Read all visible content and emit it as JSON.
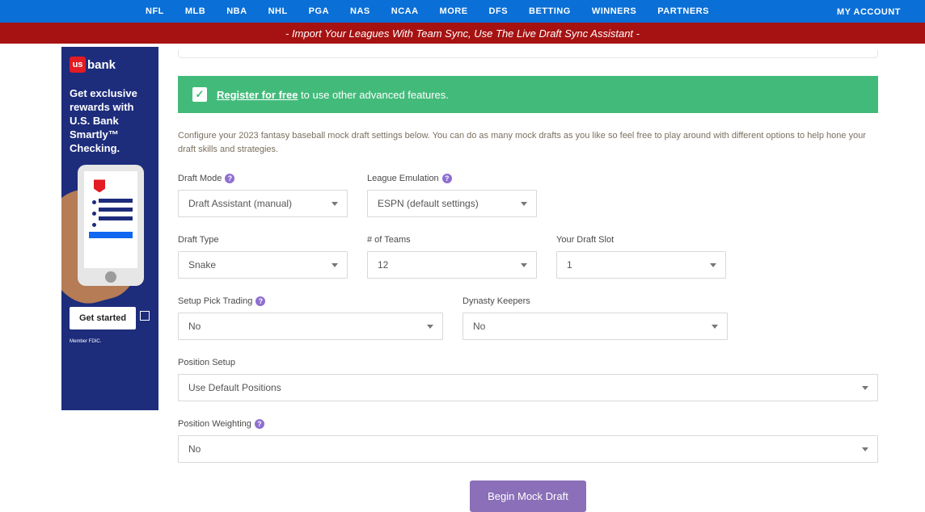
{
  "topnav": {
    "items": [
      "NFL",
      "MLB",
      "NBA",
      "NHL",
      "PGA",
      "NAS",
      "NCAA",
      "MORE",
      "DFS",
      "BETTING",
      "WINNERS",
      "PARTNERS"
    ],
    "account": "MY ACCOUNT"
  },
  "import_bar": "- Import Your Leagues With Team Sync, Use The Live Draft Sync Assistant -",
  "ad": {
    "logo_text": "bank",
    "logo_us": "us",
    "copy": "Get exclusive rewards with U.S. Bank Smartly™ Checking.",
    "cta": "Get started",
    "disclaim": "Member FDIC."
  },
  "banner": {
    "link": "Register for free",
    "rest": " to use other advanced features."
  },
  "intro": "Configure your 2023 fantasy baseball mock draft settings below. You can do as many mock drafts as you like so feel free to play around with different options to help hone your draft skills and strategies.",
  "form": {
    "draft_mode": {
      "label": "Draft Mode",
      "value": "Draft Assistant (manual)"
    },
    "league_emulation": {
      "label": "League Emulation",
      "value": "ESPN (default settings)"
    },
    "draft_type": {
      "label": "Draft Type",
      "value": "Snake"
    },
    "num_teams": {
      "label": "# of Teams",
      "value": "12"
    },
    "draft_slot": {
      "label": "Your Draft Slot",
      "value": "1"
    },
    "pick_trading": {
      "label": "Setup Pick Trading",
      "value": "No"
    },
    "dynasty_keepers": {
      "label": "Dynasty Keepers",
      "value": "No"
    },
    "position_setup": {
      "label": "Position Setup",
      "value": "Use Default Positions"
    },
    "position_weighting": {
      "label": "Position Weighting",
      "value": "No"
    }
  },
  "begin_button": "Begin Mock Draft"
}
